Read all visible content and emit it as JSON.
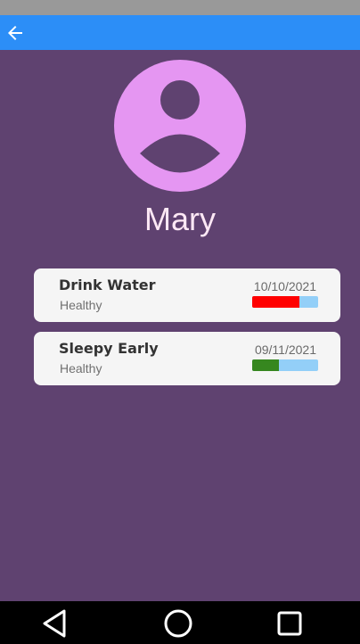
{
  "app_bar": {
    "back_icon": "arrow-left-icon",
    "color": "#2c8ef7"
  },
  "profile": {
    "name": "Mary",
    "avatar_icon": "person-icon",
    "avatar_color": "#e596f2",
    "background": "#5f4270"
  },
  "habits": [
    {
      "title": "Drink Water",
      "status": "Healthy",
      "date": "10/10/2021",
      "progress": 0.72,
      "progress_color": "#ff0000"
    },
    {
      "title": "Sleepy Early",
      "status": "Healthy",
      "date": "09/11/2021",
      "progress": 0.4,
      "progress_color": "#36871f"
    }
  ],
  "progress_track_color": "#93cff8",
  "nav": {
    "back_icon": "triangle-back-icon",
    "home_icon": "circle-home-icon",
    "recents_icon": "square-recents-icon"
  }
}
